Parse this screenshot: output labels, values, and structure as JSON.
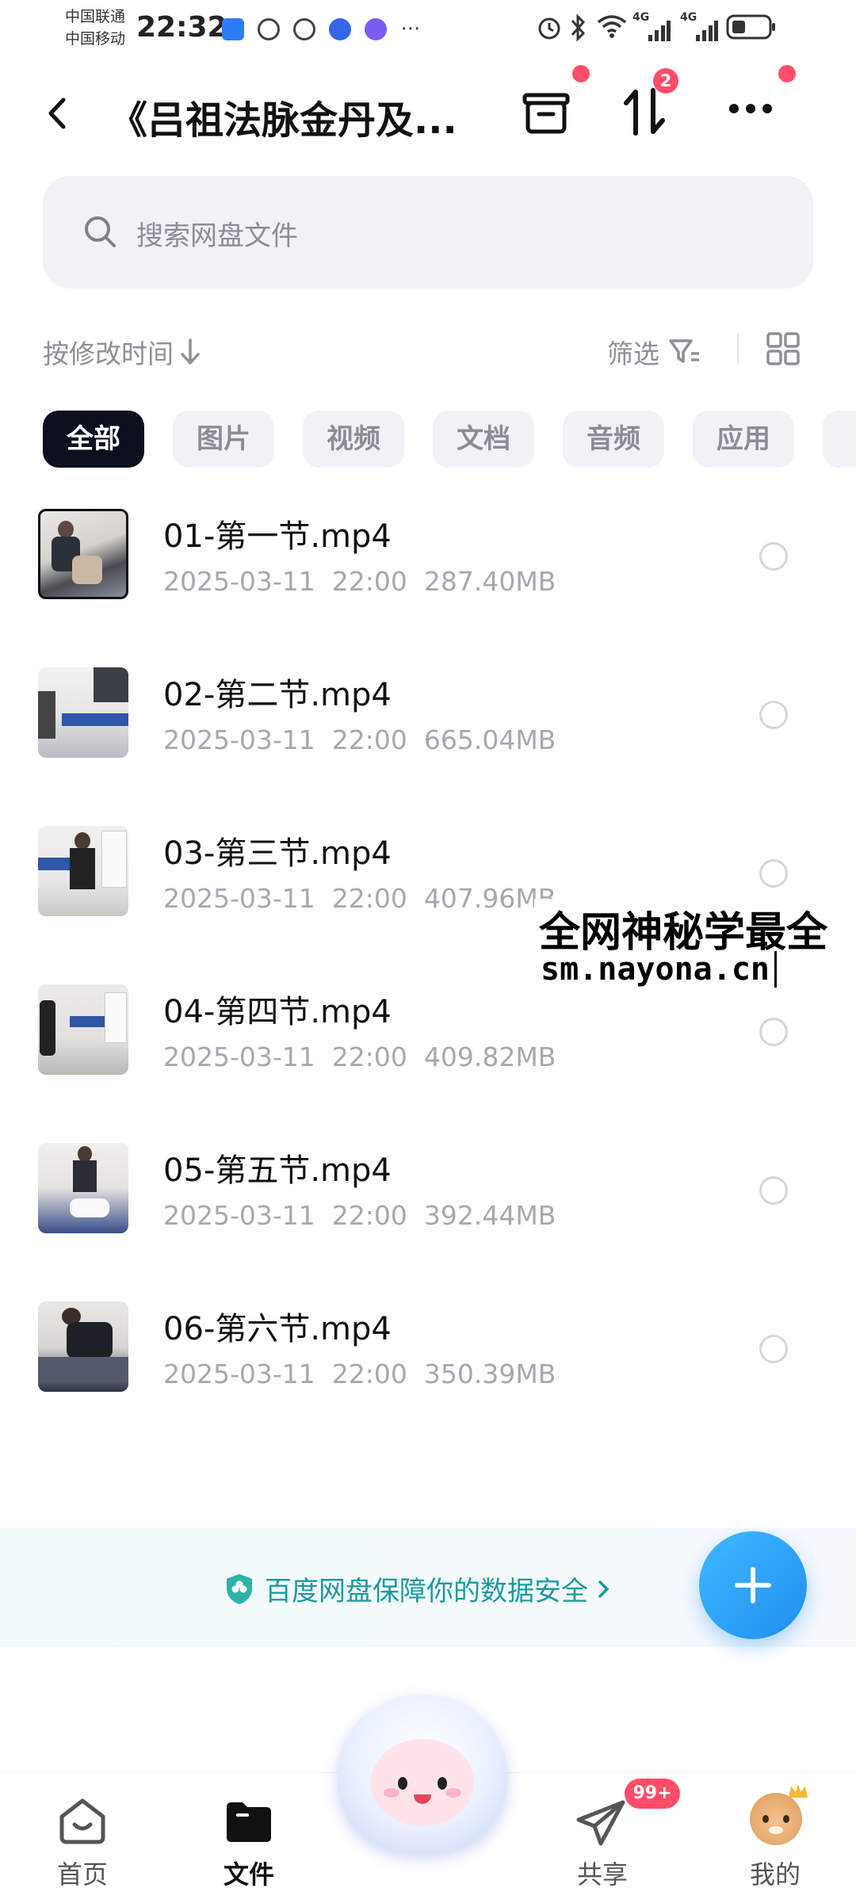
{
  "status_bar": {
    "carrier1": "中国联通",
    "carrier2": "中国移动",
    "time": "22:32",
    "more": "···",
    "signal1": "4G",
    "signal2": "4G"
  },
  "header": {
    "back_icon": "chevron-left-icon",
    "title": "《吕祖法脉金丹及...",
    "transfer_badge": "2"
  },
  "search": {
    "placeholder": "搜索网盘文件"
  },
  "sort": {
    "label": "按修改时间",
    "filter_label": "筛选"
  },
  "categories": [
    "全部",
    "图片",
    "视频",
    "文档",
    "音频",
    "应用"
  ],
  "files": [
    {
      "name": "01-第一节.mp4",
      "date": "2025-03-11",
      "time": "22:00",
      "size": "287.40MB"
    },
    {
      "name": "02-第二节.mp4",
      "date": "2025-03-11",
      "time": "22:00",
      "size": "665.04MB"
    },
    {
      "name": "03-第三节.mp4",
      "date": "2025-03-11",
      "time": "22:00",
      "size": "407.96MB"
    },
    {
      "name": "04-第四节.mp4",
      "date": "2025-03-11",
      "time": "22:00",
      "size": "409.82MB"
    },
    {
      "name": "05-第五节.mp4",
      "date": "2025-03-11",
      "time": "22:00",
      "size": "392.44MB"
    },
    {
      "name": "06-第六节.mp4",
      "date": "2025-03-11",
      "time": "22:00",
      "size": "350.39MB"
    }
  ],
  "watermark": {
    "line1": "全网神秘学最全",
    "line2": "sm.nayona.cn"
  },
  "security_banner": "百度网盘保障你的数据安全",
  "nav": {
    "home": "首页",
    "files": "文件",
    "share": "共享",
    "share_badge": "99+",
    "mine": "我的"
  },
  "colors": {
    "accent": "#1e8fef",
    "badge": "#ff4d6a",
    "chip_active": "#0c0f1d",
    "security_text": "#1a9aa0"
  }
}
